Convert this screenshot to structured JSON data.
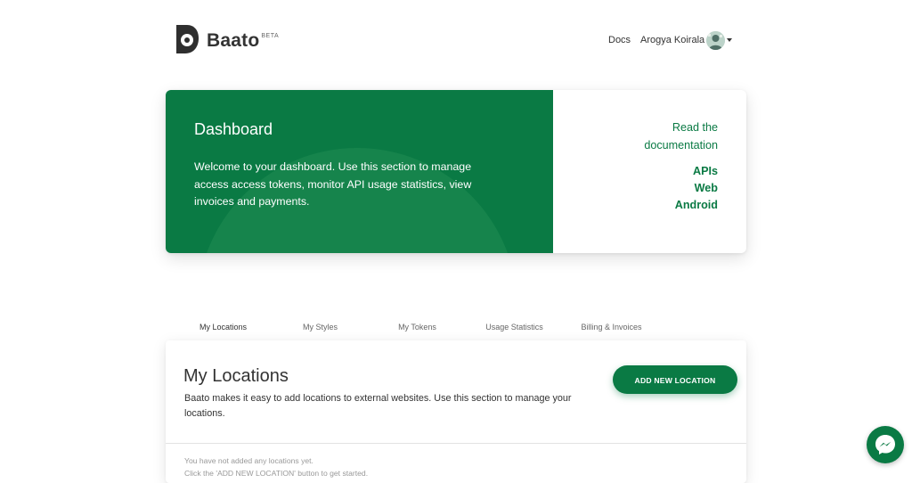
{
  "header": {
    "brand": "Baato",
    "brand_badge": "BETA",
    "nav_docs": "Docs",
    "user_name": "Arogya Koirala"
  },
  "hero": {
    "title": "Dashboard",
    "description": "Welcome to your dashboard. Use this section to manage access access tokens, monitor API usage statistics, view invoices and payments.",
    "read_docs": "Read the documentation",
    "links": [
      "APIs",
      "Web",
      "Android"
    ]
  },
  "tabs": [
    {
      "label": "My Locations",
      "active": true
    },
    {
      "label": "My Styles",
      "active": false
    },
    {
      "label": "My Tokens",
      "active": false
    },
    {
      "label": "Usage Statistics",
      "active": false
    },
    {
      "label": "Billing & Invoices",
      "active": false
    }
  ],
  "locations": {
    "title": "My Locations",
    "description": "Baato makes it easy to add locations to external websites. Use this section to manage your locations.",
    "add_button": "ADD NEW LOCATION",
    "empty_line1": "You have not added any locations yet.",
    "empty_line2": "Click the 'ADD NEW LOCATION' button to get started."
  },
  "colors": {
    "brand_green": "#0a7a44",
    "text_dark": "#333333"
  },
  "icons": {
    "logo": "baato-logo-icon",
    "avatar": "user-avatar",
    "caret": "caret-down-icon",
    "messenger": "messenger-icon"
  }
}
